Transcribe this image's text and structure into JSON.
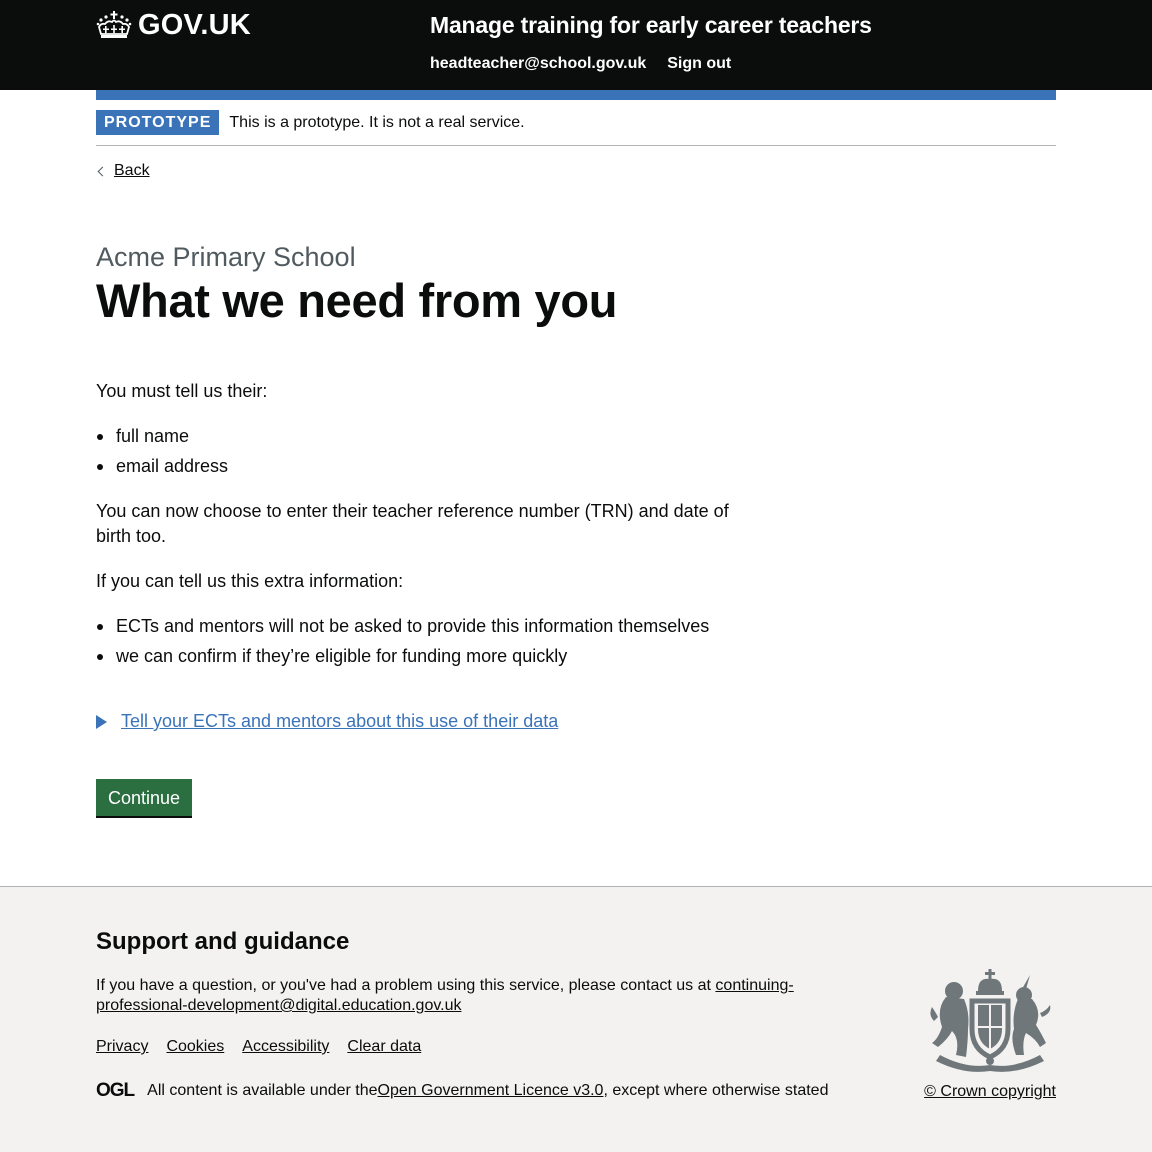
{
  "header": {
    "logo_text": "GOV.UK",
    "service_name": "Manage training for early career teachers",
    "nav": {
      "user_email": "headteacher@school.gov.uk",
      "sign_out": "Sign out"
    }
  },
  "phase_banner": {
    "tag": "PROTOTYPE",
    "text": "This is a prototype. It is not a real service."
  },
  "back_link": "Back",
  "main": {
    "caption": "Acme Primary School",
    "title": "What we need from you",
    "intro": "You must tell us their:",
    "required_items": [
      "full name",
      "email address"
    ],
    "optional_para": "You can now choose to enter their teacher reference number (TRN) and date of birth too.",
    "extra_intro": "If you can tell us this extra information:",
    "extra_items": [
      "ECTs and mentors will not be asked to provide this information themselves",
      "we can confirm if they’re eligible for funding more quickly"
    ],
    "details_summary": "Tell your ECTs and mentors about this use of their data",
    "continue_button": "Continue"
  },
  "footer": {
    "heading": "Support and guidance",
    "contact_text": "If you have a question, or you've had a problem using this service, please contact us at ",
    "contact_email": "continuing-professional-development@digital.education.gov.uk",
    "links": [
      "Privacy",
      "Cookies",
      "Accessibility",
      "Clear data"
    ],
    "ogl_logo": "OGL",
    "licence_prefix": "All content is available under the ",
    "licence_link": "Open Government Licence v3.0",
    "licence_suffix": ", except where otherwise stated",
    "copyright": "© Crown copyright"
  },
  "colors": {
    "header_bg": "#0b0c0c",
    "accent_blue": "#3b73b9",
    "button_green": "#2b6e40",
    "caption_grey": "#505a5f",
    "footer_bg": "#f3f2f1"
  }
}
